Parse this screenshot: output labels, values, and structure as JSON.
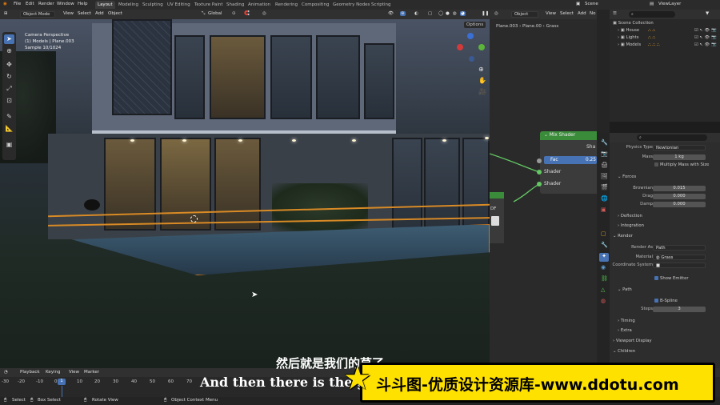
{
  "topbar": {
    "menus": [
      "File",
      "Edit",
      "Render",
      "Window",
      "Help"
    ],
    "workspaces": [
      "Layout",
      "Modeling",
      "Sculpting",
      "UV Editing",
      "Texture Paint",
      "Shading",
      "Animation",
      "Rendering",
      "Compositing",
      "Geometry Nodes",
      "Scripting"
    ],
    "active_workspace": "Layout",
    "scene": "Scene",
    "view_layer": "ViewLayer"
  },
  "viewport_header": {
    "mode": "Object Mode",
    "menus": [
      "View",
      "Select",
      "Add",
      "Object"
    ],
    "orientation": "Global",
    "options": "Options"
  },
  "viewport": {
    "camera_info": "Camera Perspective",
    "object_info": "(1) Models | Plane.003",
    "sample_info": "Sample 10/1024"
  },
  "node_editor": {
    "mode": "Object",
    "menus": [
      "View",
      "Select",
      "Add",
      "No"
    ],
    "breadcrumb": [
      "Plane.003",
      "Plane.00",
      "Grass"
    ],
    "mix_node": {
      "title": "Mix Shader",
      "output": "Sha",
      "fac_label": "Fac",
      "fac_value": "0.25",
      "input1": "Shader",
      "input2": "Shader"
    },
    "partial_node_label": "DF"
  },
  "outliner": {
    "root": "Scene Collection",
    "items": [
      "House",
      "Lights",
      "Models"
    ]
  },
  "properties": {
    "physics_type_label": "Physics Type",
    "physics_type": "Newtonian",
    "mass_label": "Mass",
    "mass": "1 kg",
    "multiply_mass": "Multiply Mass with Size",
    "forces_header": "Forces",
    "brownian_label": "Brownian",
    "brownian": "0.015",
    "drag_label": "Drag",
    "drag": "0.000",
    "damp_label": "Damp",
    "damp": "0.000",
    "deflection_header": "Deflection",
    "integration_header": "Integration",
    "render_header": "Render",
    "render_as_label": "Render As",
    "render_as": "Path",
    "material_label": "Material",
    "material": "Grass",
    "coord_label": "Coordinate System",
    "show_emitter": "Show Emitter",
    "path_header": "Path",
    "bspline": "B-Spline",
    "steps_label": "Steps",
    "steps": "3",
    "timing_header": "Timing",
    "extra_header": "Extra",
    "viewport_display_header": "Viewport Display",
    "children_header": "Children"
  },
  "timeline": {
    "menus": [
      "Playback",
      "Keying",
      "View",
      "Marker"
    ],
    "current_frame": "1",
    "ticks": [
      "-30",
      "-20",
      "-10",
      "0",
      "1",
      "10",
      "20",
      "30",
      "40",
      "50",
      "60",
      "70"
    ]
  },
  "status": {
    "items": [
      "Select",
      "Box Select",
      "Rotate View",
      "Object Context Menu"
    ]
  },
  "subtitles": {
    "chinese": "然后就是我们的草了",
    "english": "And then there is the grass"
  },
  "watermark": {
    "text": "斗斗图-优质设计资源库-www.ddotu.com",
    "colors": {
      "bg": "#ffe100",
      "text": "#000000"
    }
  },
  "colors": {
    "accent": "#4772b3",
    "node_header": "#3a8c3a",
    "socket": "#63c763"
  }
}
